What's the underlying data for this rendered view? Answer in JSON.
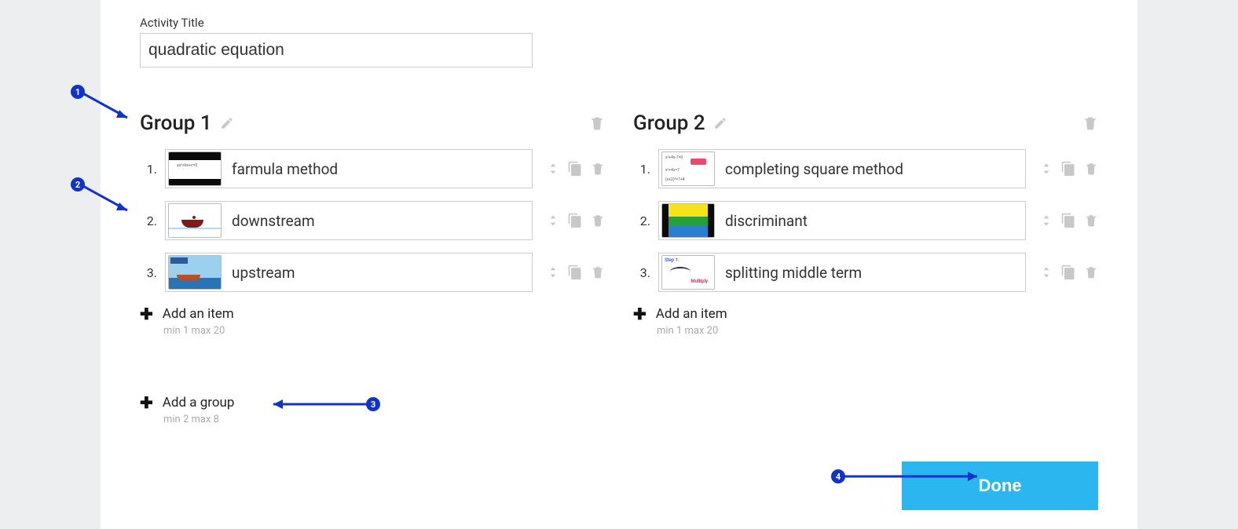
{
  "title_label": "Activity Title",
  "title_value": "quadratic equation",
  "groups": [
    {
      "title": "Group 1",
      "items": [
        {
          "num": "1.",
          "label": "farmula method"
        },
        {
          "num": "2.",
          "label": "downstream"
        },
        {
          "num": "3.",
          "label": "upstream"
        }
      ]
    },
    {
      "title": "Group 2",
      "items": [
        {
          "num": "1.",
          "label": "completing square method"
        },
        {
          "num": "2.",
          "label": "discriminant"
        },
        {
          "num": "3.",
          "label": "splitting middle term"
        }
      ]
    }
  ],
  "add_item_label": "Add an item",
  "add_item_hint": "min 1   max 20",
  "add_group_label": "Add a group",
  "add_group_hint": "min 2   max 8",
  "done_label": "Done",
  "annotations": {
    "a1": "1",
    "a2": "2",
    "a3": "3",
    "a4": "4"
  }
}
